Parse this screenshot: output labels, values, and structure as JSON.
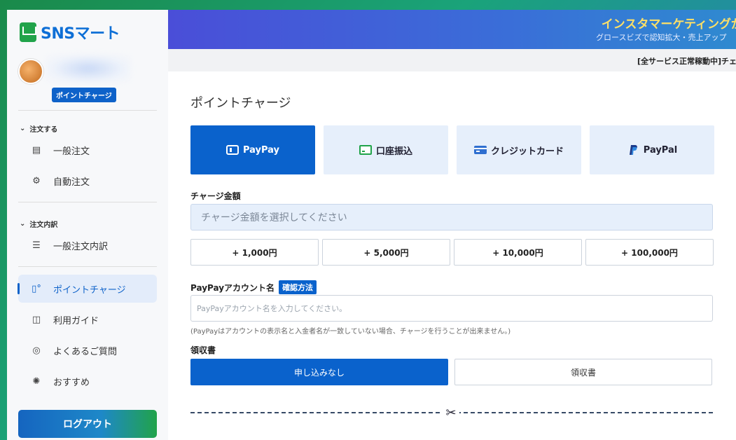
{
  "sidebar": {
    "logo_text": "SNSマート",
    "profile_badge": "ポイントチャージ",
    "sections": [
      {
        "title": "注文する",
        "items": [
          "一般注文",
          "自動注文"
        ]
      },
      {
        "title": "注文内訳",
        "items": [
          "一般注文内訳"
        ]
      }
    ],
    "items_bottom": [
      "ポイントチャージ",
      "利用ガイド",
      "よくあるご質問",
      "おすすめ"
    ],
    "logout": "ログアウト"
  },
  "banner": {
    "title": "インスタマーケティングが",
    "subtitle": "グロースビズで認知拡大・売上アップ"
  },
  "notice": "[全サービス正常稼動中]チェ",
  "main": {
    "title": "ポイントチャージ",
    "pay_methods": [
      "PayPay",
      "口座振込",
      "クレジットカード",
      "PayPal"
    ],
    "amount_label": "チャージ金額",
    "amount_placeholder": "チャージ金額を選択してください",
    "amount_options": [
      "+ 1,000円",
      "+ 5,000円",
      "+ 10,000円",
      "+ 100,000円"
    ],
    "account_label": "PayPayアカウント名",
    "confirm_badge": "確認方法",
    "account_placeholder": "PayPayアカウント名を入力してください。",
    "help_text": "(PayPayはアカウントの表示名と入金者名が一致していない場合、チャージを行うことが出来ません。)",
    "receipt_label": "領収書",
    "receipt_options": [
      "申し込みなし",
      "領収書"
    ]
  },
  "colors": {
    "accent": "#0a62cc",
    "brand_green": "#21a34a",
    "banner_highlight": "#ffe066"
  }
}
